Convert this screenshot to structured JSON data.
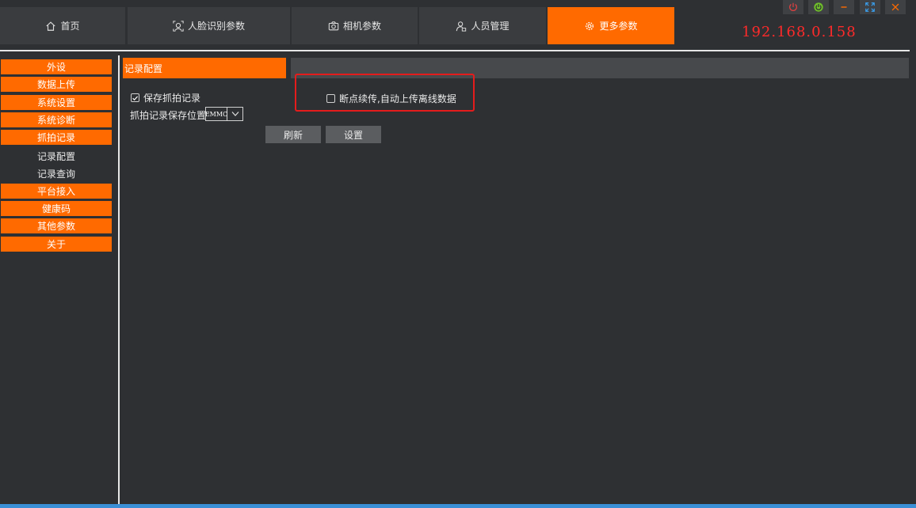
{
  "tabs": [
    {
      "label": "首页",
      "icon": "home-icon"
    },
    {
      "label": "人脸识别参数",
      "icon": "face-recognition-icon"
    },
    {
      "label": "相机参数",
      "icon": "camera-icon"
    },
    {
      "label": "人员管理",
      "icon": "user-manage-icon"
    },
    {
      "label": "更多参数",
      "icon": "gear-icon",
      "active": true
    }
  ],
  "ip_address": "192.168.0.158",
  "window_controls": [
    "power-icon",
    "power-on-icon",
    "minimize-icon",
    "fullscreen-icon",
    "close-icon"
  ],
  "sidebar": {
    "items": [
      {
        "label": "外设",
        "style": "orange"
      },
      {
        "label": "数据上传",
        "style": "orange"
      },
      {
        "label": "系统设置",
        "style": "orange"
      },
      {
        "label": "系统诊断",
        "style": "orange"
      },
      {
        "label": "抓拍记录",
        "style": "orange"
      },
      {
        "label": "记录配置",
        "style": "sub",
        "selected": true
      },
      {
        "label": "记录查询",
        "style": "sub"
      },
      {
        "label": "平台接入",
        "style": "orange"
      },
      {
        "label": "健康码",
        "style": "orange"
      },
      {
        "label": "其他参数",
        "style": "orange"
      },
      {
        "label": "关于",
        "style": "orange"
      }
    ]
  },
  "panel": {
    "title": "记录配置",
    "save_record": {
      "label": "保存抓拍记录",
      "checked": true
    },
    "resume_upload": {
      "label": "断点续传,自动上传离线数据",
      "checked": false
    },
    "save_location_label": "抓拍记录保存位置",
    "save_location_value": "EMMC",
    "refresh_label": "刷新",
    "set_label": "设置"
  },
  "colors": {
    "accent": "#ff6a00",
    "background": "#2e3033",
    "highlight": "#e51c1c",
    "ip_text": "#ff2a2a"
  }
}
